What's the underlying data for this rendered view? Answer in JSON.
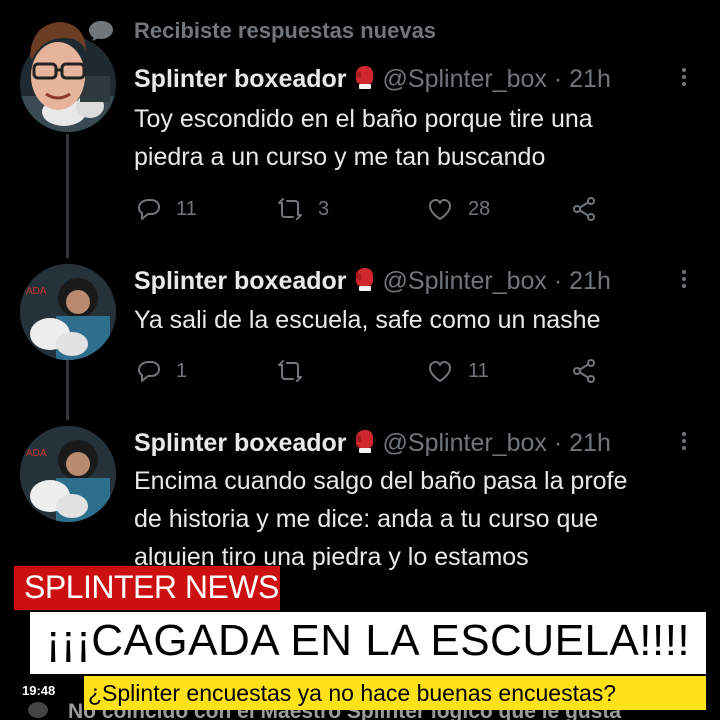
{
  "notification": {
    "text": "Recibiste respuestas nuevas",
    "icon": "speech-bubble-icon"
  },
  "tweets": [
    {
      "name": "Splinter boxeador",
      "emoji": "boxing-glove-icon",
      "handle": "@Splinter_box",
      "time": "· 21h",
      "lines": [
        "Toy escondido en el baño porque tire una",
        "piedra a un curso y me tan buscando"
      ],
      "replies": "11",
      "retweets": "3",
      "likes": "28"
    },
    {
      "name": "Splinter boxeador",
      "emoji": "boxing-glove-icon",
      "handle": "@Splinter_box",
      "time": "· 21h",
      "lines": [
        "Ya sali de la escuela, safe como un nashe"
      ],
      "replies": "1",
      "retweets": "",
      "likes": "11"
    },
    {
      "name": "Splinter boxeador",
      "emoji": "boxing-glove-icon",
      "handle": "@Splinter_box",
      "time": "· 21h",
      "lines": [
        "Encima cuando salgo del baño pasa la profe",
        "de historia y me dice: anda a tu curso que",
        "alguien tiro una piedra y lo estamos"
      ]
    }
  ],
  "overlay": {
    "news_label": "SPLINTER NEWS",
    "headline": "¡¡¡CAGADA EN LA ESCUELA!!!!",
    "clock": "19:48",
    "ticker": "¿Splinter encuestas ya no hace buenas encuestas?",
    "underlying_text": "No coincido con el Maestro Splinter lógico que le gusta",
    "colors": {
      "news_red": "#cc1010",
      "ticker_yellow": "#ffe11a",
      "twitter_gray": "#71767b"
    }
  }
}
